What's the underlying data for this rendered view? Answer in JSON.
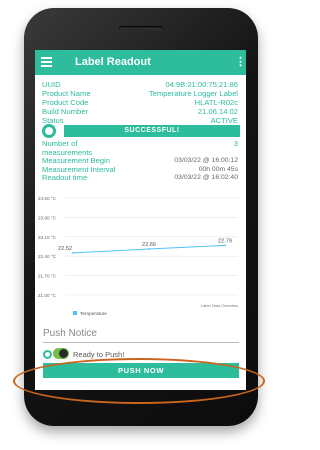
{
  "app_bar": {
    "title": "Label Readout"
  },
  "info": [
    {
      "label": "UUID",
      "value": "04:9B:21:00:75:21:86"
    },
    {
      "label": "Product Name",
      "value": "Temperature Logger Label"
    },
    {
      "label": "Product Code",
      "value": "HLATL-R02c"
    },
    {
      "label": "Build Number",
      "value": "21.06.14.02"
    },
    {
      "label": "Status",
      "value": "ACTIVE"
    }
  ],
  "status_bar": {
    "label": "SUCCESSFUL!"
  },
  "readout": {
    "num_measurements_label": "Number of measurements",
    "num_measurements_value": "3",
    "measurement_begin_label": "Measurement Begin",
    "measurement_begin_value": "03/03/22 @ 16:00:12",
    "measurement_interval_label": "Measurement Interval",
    "measurement_interval_value": "00h 00m 45s",
    "readout_time_label": "Readout time",
    "readout_time_value": "03/03/22 @ 16:02:40"
  },
  "chart_data": {
    "type": "line",
    "x": [
      1,
      2,
      3
    ],
    "series": [
      {
        "name": "Temperature",
        "values": [
          22.52,
          22.66,
          22.79
        ]
      }
    ],
    "point_labels": [
      "22.52",
      "22.66",
      "22.79"
    ],
    "yticks": [
      "24.50 °C",
      "23.80 °C",
      "23.10 °C",
      "22.40 °C",
      "21.70 °C",
      "21.00 °C"
    ],
    "ytick_values": [
      24.5,
      23.8,
      23.1,
      22.4,
      21.7,
      21.0
    ],
    "ylim": [
      21.0,
      24.5
    ],
    "description_label": "Label Data Overview",
    "legend": "bottom-left",
    "grid": true,
    "line_color": "#4fc3f7"
  },
  "push": {
    "title": "Push Notice",
    "ready_text": "Ready to Push!",
    "button_label": "PUSH NOW"
  },
  "colors": {
    "accent": "#2dbc9c",
    "highlight": "#c9651d"
  },
  "icons": {
    "menu": "hamburger-menu-icon",
    "more": "more-vert-icon",
    "toggle": "toggle-icon"
  }
}
